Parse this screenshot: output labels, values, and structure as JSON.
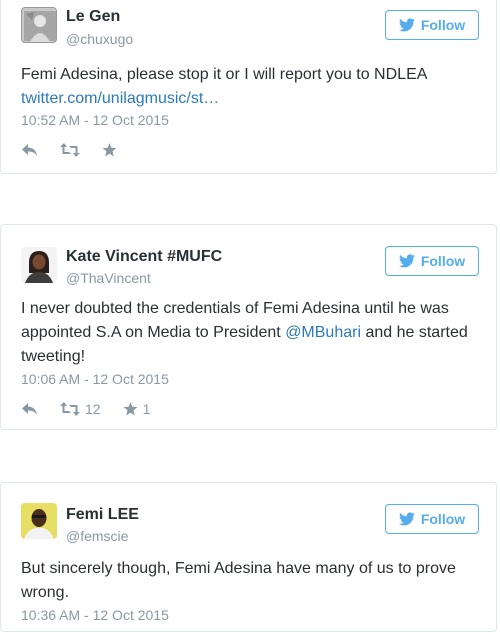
{
  "tweets": [
    {
      "name": "Le Gen",
      "handle": "@chuxugo",
      "follow_label": "Follow",
      "text": "Femi Adesina, please stop it or I will report you to NDLEA",
      "link": "twitter.com/unilagmusic/st…",
      "time": "10:52 AM - 12 Oct 2015",
      "retweets": "",
      "likes": ""
    },
    {
      "name": "Kate Vincent #MUFC",
      "handle": "@ThaVincent",
      "follow_label": "Follow",
      "text_before": "I never doubted the credentials of Femi Adesina until he was appointed S.A on Media to President ",
      "mention": "@MBuhari",
      "text_after": " and he started tweeting!",
      "time": "10:06 AM - 12 Oct 2015",
      "retweets": "12",
      "likes": "1"
    },
    {
      "name": "Femi LEE",
      "handle": "@femscie",
      "follow_label": "Follow",
      "text": "But sincerely though, Femi Adesina have many of us to prove wrong.",
      "time": "10:36 AM - 12 Oct 2015"
    }
  ],
  "colors": {
    "accent": "#55acee",
    "link": "#2b7bb9",
    "muted": "#8899a6",
    "border": "#e1e8ed"
  },
  "icons": [
    "twitter-bird-icon",
    "reply-icon",
    "retweet-icon",
    "favorite-star-icon"
  ]
}
